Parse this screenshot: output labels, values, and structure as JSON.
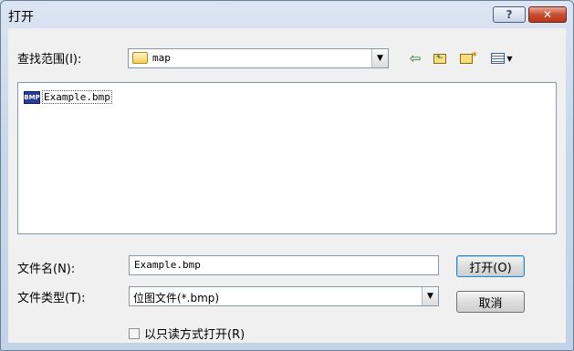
{
  "window": {
    "title": "打开",
    "help_label": "?",
    "close_label": "✕"
  },
  "lookin": {
    "label": "查找范围(I):",
    "value": "map"
  },
  "toolbar": {
    "icons": [
      "back-icon",
      "up-one-level-icon",
      "new-folder-icon",
      "views-menu-icon"
    ]
  },
  "files": [
    {
      "name": "Example.bmp",
      "icon_text": "BMP",
      "icon": "bmp-file-icon"
    }
  ],
  "filename": {
    "label": "文件名(N):",
    "value": "Example.bmp"
  },
  "filetype": {
    "label": "文件类型(T):",
    "value": "位图文件(*.bmp)"
  },
  "buttons": {
    "open": "打开(O)",
    "cancel": "取消"
  },
  "readonly": {
    "label": "以只读方式打开(R)",
    "checked": false
  }
}
